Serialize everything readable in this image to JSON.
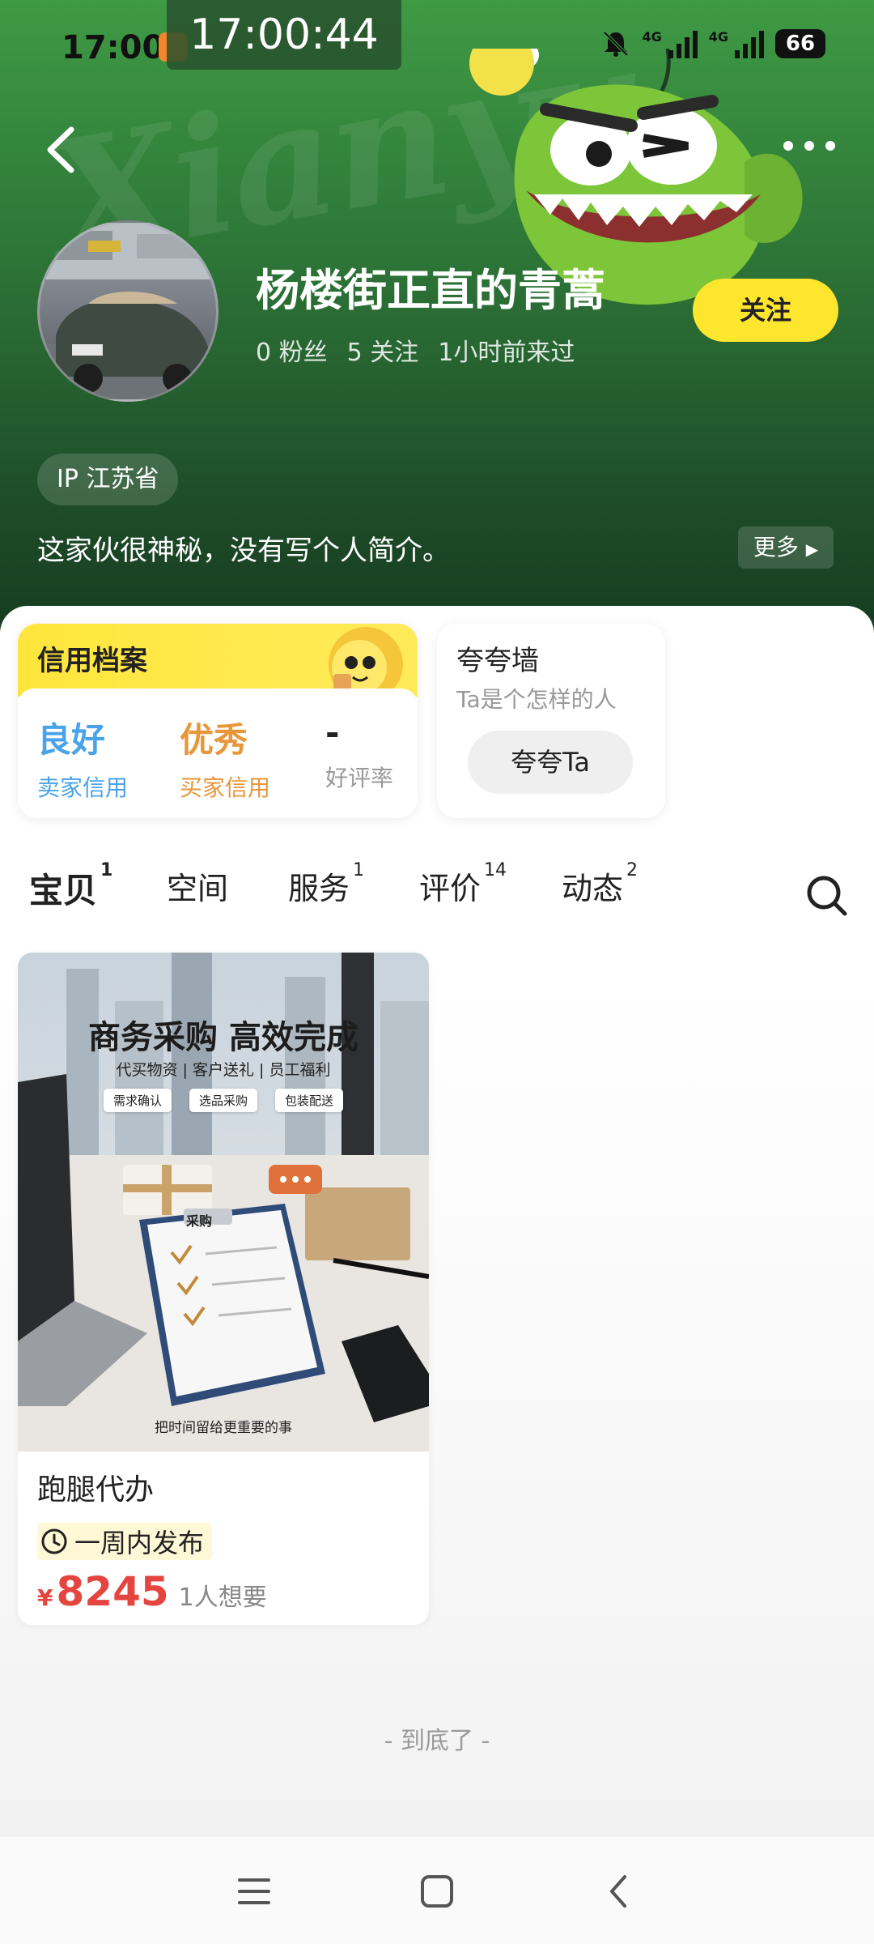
{
  "status_bar": {
    "time": "17:00",
    "clock_overlay": "17:00:44",
    "network_1": "4G",
    "network_2": "4G",
    "battery": "66"
  },
  "profile": {
    "username": "杨楼街正直的青蒿",
    "fans": "0 粉丝",
    "following": "5 关注",
    "last_seen": "1小时前来过",
    "follow_label": "关注",
    "ip_location": "IP 江苏省",
    "bio": "这家伙很神秘，没有写个人简介。",
    "more_label": "更多"
  },
  "credit_card": {
    "title": "信用档案",
    "items": [
      {
        "value": "良好",
        "label": "卖家信用",
        "color": "#4aa3e8"
      },
      {
        "value": "优秀",
        "label": "买家信用",
        "color": "#e8963a"
      },
      {
        "value": "-",
        "label": "好评率",
        "color": "#222222"
      }
    ]
  },
  "praise_wall": {
    "title": "夸夸墙",
    "subtitle": "Ta是个怎样的人",
    "button": "夸夸Ta"
  },
  "tabs": [
    {
      "label": "宝贝",
      "count": "1",
      "active": true
    },
    {
      "label": "空间",
      "count": "",
      "active": false
    },
    {
      "label": "服务",
      "count": "1",
      "active": false
    },
    {
      "label": "评价",
      "count": "14",
      "active": false
    },
    {
      "label": "动态",
      "count": "2",
      "active": false
    }
  ],
  "product": {
    "image_headline": "商务采购 高效完成",
    "image_subline": "代买物资 | 客户送礼 | 员工福利",
    "image_tags": [
      "需求确认",
      "选品采购",
      "包装配送"
    ],
    "image_clipboard_label": "采购",
    "image_footer": "把时间留给更重要的事",
    "title": "跑腿代办",
    "time_badge": "一周内发布",
    "price_symbol": "¥",
    "price": "8245",
    "wants": "1人想要"
  },
  "end_text": "- 到底了 -",
  "colors": {
    "accent_yellow": "#ffe62e",
    "price_red": "#e4453f",
    "header_green": "#2f7a39"
  }
}
